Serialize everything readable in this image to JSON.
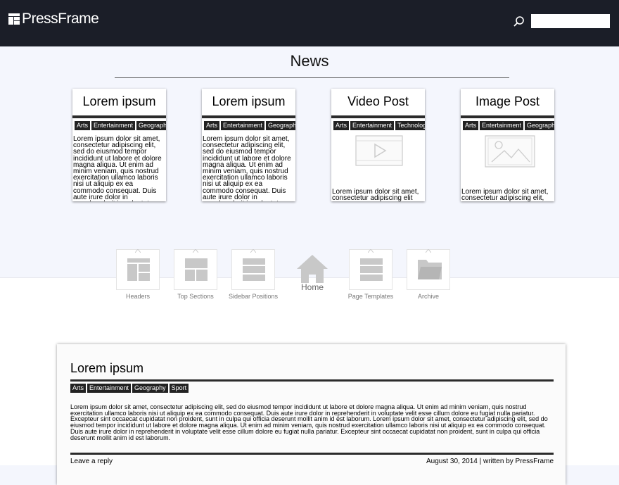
{
  "header": {
    "logo_text": "PressFrame",
    "search": {
      "value": "",
      "placeholder": ""
    },
    "bg_color": "#1b1e28"
  },
  "news": {
    "title": "News",
    "cards": [
      {
        "title": "Lorem ipsum",
        "tags": [
          "Arts",
          "Entertainment",
          "Geography"
        ],
        "type": "text",
        "excerpt": "Lorem ipsum dolor sit amet, consectetur adipiscing elit, sed do eiusmod tempor incididunt ut labore et dolore magna aliqua. Ut enim ad minim veniam, quis nostrud exercitation ullamco laboris nisi ut aliquip ex ea commodo consequat. Duis aute irure dolor in reprehenderit in voluptate"
      },
      {
        "title": "Lorem ipsum",
        "tags": [
          "Arts",
          "Entertainment",
          "Geography"
        ],
        "type": "text",
        "excerpt": "Lorem ipsum dolor sit amet, consectetur adipiscing elit, sed do eiusmod tempor incididunt ut labore et dolore magna aliqua. Ut enim ad minim veniam, quis nostrud exercitation ullamco laboris nisi ut aliquip ex ea commodo consequat. Duis aute irure dolor in reprehenderit in voluptate"
      },
      {
        "title": "Video Post",
        "tags": [
          "Arts",
          "Entertainment",
          "Technology"
        ],
        "type": "video",
        "excerpt": "Lorem ipsum dolor sit amet, consectetur adipiscing elit"
      },
      {
        "title": "Image Post",
        "tags": [
          "Arts",
          "Entertainment",
          "Geography"
        ],
        "type": "image",
        "excerpt": "Lorem ipsum dolor sit amet, consectetur adipiscing elit, sed do eiusmod tempor"
      }
    ]
  },
  "nav": {
    "items": [
      {
        "label": "Headers",
        "icon": "headers-icon"
      },
      {
        "label": "Top Sections",
        "icon": "top-sections-icon"
      },
      {
        "label": "Sidebar Positions",
        "icon": "sidebar-positions-icon"
      },
      {
        "label": "Page Templates",
        "icon": "page-templates-icon"
      },
      {
        "label": "Archive",
        "icon": "folder-icon"
      }
    ],
    "home_label": "Home"
  },
  "post": {
    "title": "Lorem ipsum",
    "tags": [
      "Arts",
      "Entertainment",
      "Geography",
      "Sport"
    ],
    "body": "Lorem ipsum dolor sit amet, consectetur adipiscing elit, sed do eiusmod tempor incididunt ut labore et dolore magna aliqua. Ut enim ad minim veniam, quis nostrud exercitation ullamco laboris nisi ut aliquip ex ea commodo consequat. Duis aute irure dolor in reprehenderit in voluptate velit esse cillum dolore eu fugiat nulla pariatur. Excepteur sint occaecat cupidatat non proident, sunt in culpa qui officia deserunt mollit anim id est laborum. Lorem ipsum dolor sit amet, consectetur adipiscing elit, sed do eiusmod tempor incididunt ut labore et dolore magna aliqua. Ut enim ad minim veniam, quis nostrud exercitation ullamco laboris nisi ut aliquip ex ea commodo consequat. Duis aute irure dolor in reprehenderit in voluptate velit esse cillum dolore eu fugiat nulla pariatur. Excepteur sint occaecat cupidatat non proident, sunt in culpa qui officia deserunt mollit anim id est laborum.",
    "reply_label": "Leave a reply",
    "meta": "August 30, 2014 | written by PressFrame"
  }
}
